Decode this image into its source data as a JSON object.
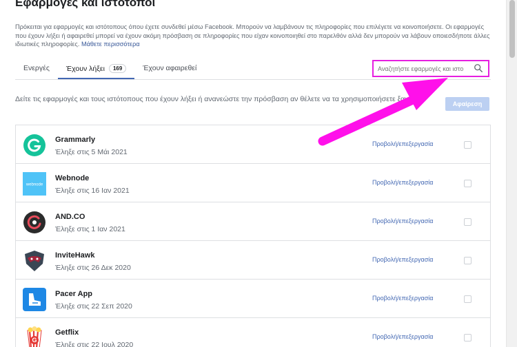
{
  "header": {
    "title": "Εφαρμογές και ιστότοποι",
    "description": "Πρόκειται για εφαρμογές και ιστότοπους όπου έχετε συνδεθεί μέσω Facebook. Μπορούν να λαμβάνουν τις πληροφορίες που επιλέγετε να κοινοποιήσετε. Οι εφαρμογές που έχουν λήξει ή αφαιρεθεί μπορεί να έχουν ακόμη πρόσβαση σε πληροφορίες που είχαν κοινοποιηθεί στο παρελθόν αλλά δεν μπορούν να λάβουν οποιεσδήποτε άλλες ιδιωτικές πληροφορίες.",
    "learn_more": "Μάθετε περισσότερα"
  },
  "tabs": [
    {
      "label": "Ενεργές"
    },
    {
      "label": "Έχουν λήξει",
      "count": "169"
    },
    {
      "label": "Έχουν αφαιρεθεί"
    }
  ],
  "search": {
    "placeholder": "Αναζητήστε εφαρμογές και ιστο",
    "icon": "search-icon"
  },
  "info_text": "Δείτε τις εφαρμογές και τους ιστότοπους που έχουν λήξει ή ανανεώστε την πρόσβαση αν θέλετε να τα χρησιμοποιήσετε ξανά.",
  "remove_label": "Αφαίρεση",
  "edit_label": "Προβολή/επεξεργασία",
  "apps": [
    {
      "name": "Grammarly",
      "expired": "Έληξε στις 5 Μάι 2021",
      "logo": "grammarly-logo",
      "color": "#15c39a"
    },
    {
      "name": "Webnode",
      "expired": "Έληξε στις 16 Ιαν 2021",
      "logo": "webnode-logo",
      "logo_text": "webnode",
      "color": "#4fc3f7"
    },
    {
      "name": "AND.CO",
      "expired": "Έληξε στις 1 Ιαν 2021",
      "logo": "andco-logo",
      "color": "#2b2b2b"
    },
    {
      "name": "InviteHawk",
      "expired": "Έληξε στις 26 Δεκ 2020",
      "logo": "invitehawk-logo",
      "color": "#a4243b"
    },
    {
      "name": "Pacer App",
      "expired": "Έληξε στις 22 Σεπ 2020",
      "logo": "pacer-logo",
      "color": "#1e88e5"
    },
    {
      "name": "Getflix",
      "expired": "Έληξε στις 22 Ιουλ 2020",
      "logo": "getflix-logo",
      "color": "#e53935"
    }
  ],
  "annotation_color": "#ff10ea"
}
